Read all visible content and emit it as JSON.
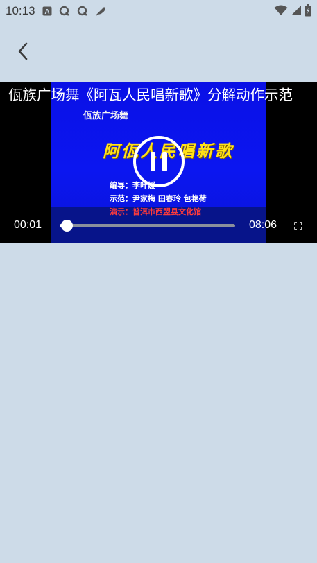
{
  "status_bar": {
    "time": "10:13",
    "left_icons": [
      "notification-a-icon",
      "q-icon",
      "q-icon",
      "feather-icon"
    ],
    "right_icons": [
      "wifi-icon",
      "signal-icon",
      "battery-icon"
    ]
  },
  "app_bar": {
    "back_icon": "chevron-left-icon"
  },
  "video": {
    "title": "佤族广场舞《阿瓦人民唱新歌》分解动作示范",
    "frame": {
      "subtitle": "佤族广场舞",
      "main_title": "阿佤人民唱新歌",
      "credit_1": "编导：李叶媛",
      "credit_2": "示范：尹家梅 田春玲 包艳荷",
      "credit_3": "演示：普洱市西盟县文化馆"
    },
    "current_time": "00:01",
    "duration": "08:06",
    "progress": 0.04,
    "state": "playing"
  },
  "colors": {
    "background": "#cddbe8",
    "player_bg": "#000000",
    "frame_blue": "#0b16f0",
    "title_yellow": "#ffe11a"
  }
}
